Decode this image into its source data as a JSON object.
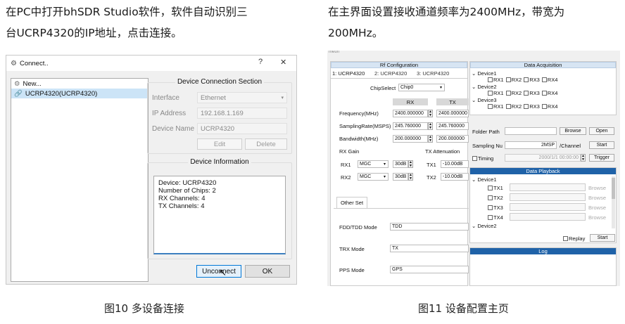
{
  "left_caption": {
    "line1": "在PC中打开bhSDR Studio软件，软件自动识别三",
    "line2": "台UCRP4320的IP地址，点击连接。"
  },
  "right_caption": {
    "line1": "在主界面设置接收通道频率为2400MHz，带宽为",
    "line2": "200MHz。"
  },
  "fig10": "图10 多设备连接",
  "fig11": "图11 设备配置主页",
  "connect_dialog": {
    "title": "Connect..",
    "help": "?",
    "close": "✕",
    "list": [
      "New...",
      "UCRP4320(UCRP4320)"
    ],
    "section_title": "Device Connection Section",
    "interface_label": "Interface",
    "interface_value": "Ethernet",
    "ip_label": "IP Address",
    "ip_value": "192.168.1.169",
    "name_label": "Device Name",
    "name_value": "UCRP4320",
    "edit": "Edit",
    "delete": "Delete",
    "info_title": "Device Information",
    "info_lines": [
      "Device: UCRP4320",
      "Number of Chips: 2",
      "RX Channels: 4",
      "TX Channels: 4"
    ],
    "unconnect": "Unconnect",
    "ok": "OK"
  },
  "main_window": {
    "title": "meun",
    "rf": {
      "title": "Rf Configuration",
      "tabs": [
        "1: UCRP4320",
        "2: UCRP4320",
        "3: UCRP4320"
      ],
      "chip_label": "ChipSelect",
      "chip_value": "Chip0",
      "col_rx": "RX",
      "col_tx": "TX",
      "rows": [
        {
          "label": "Frequency(MHz)",
          "rx": "2400.000000",
          "tx": "2400.000000"
        },
        {
          "label": "SamplingRate(MSPS)",
          "rx": "245.760000",
          "tx": "245.760000"
        },
        {
          "label": "Bandwidth(MHz)",
          "rx": "200.000000",
          "tx": "200.000000"
        }
      ],
      "rx_gain_label": "RX Gain",
      "tx_att_label": "TX Attenuation",
      "gain_rows": [
        {
          "ch": "RX1",
          "mode": "MGC",
          "db": "30dB",
          "tx": "TX1",
          "att": "-10.00dB"
        },
        {
          "ch": "RX2",
          "mode": "MGC",
          "db": "30dB",
          "tx": "TX2",
          "att": "-10.00dB"
        }
      ],
      "other_tab": "Other Set",
      "fdd_label": "FDD/TDD Mode",
      "fdd_value": "TDD",
      "trx_label": "TRX Mode",
      "trx_value": "TX",
      "pps_label": "PPS Mode",
      "pps_value": "GPS"
    },
    "acq": {
      "title": "Data Acquisition",
      "devices": [
        "Device1",
        "Device2",
        "Device3"
      ],
      "channels": [
        "RX1",
        "RX2",
        "RX3",
        "RX4"
      ],
      "folder_label": "Folder Path",
      "browse": "Browse",
      "open": "Open",
      "sampling_label": "Sampling Nu",
      "sampling_value": "2MSP",
      "per_channel": "/Channel",
      "start": "Start",
      "timing": "Timing",
      "timing_value": "2000/1/1 00:00:00",
      "trigger": "Trigger"
    },
    "play": {
      "title": "Data Playback",
      "device1": "Device1",
      "channels": [
        "TX1",
        "TX2",
        "TX3",
        "TX4"
      ],
      "browse": "Browse",
      "device2": "Device2",
      "replay": "Replay",
      "start": "Start"
    },
    "log_title": "Log"
  }
}
